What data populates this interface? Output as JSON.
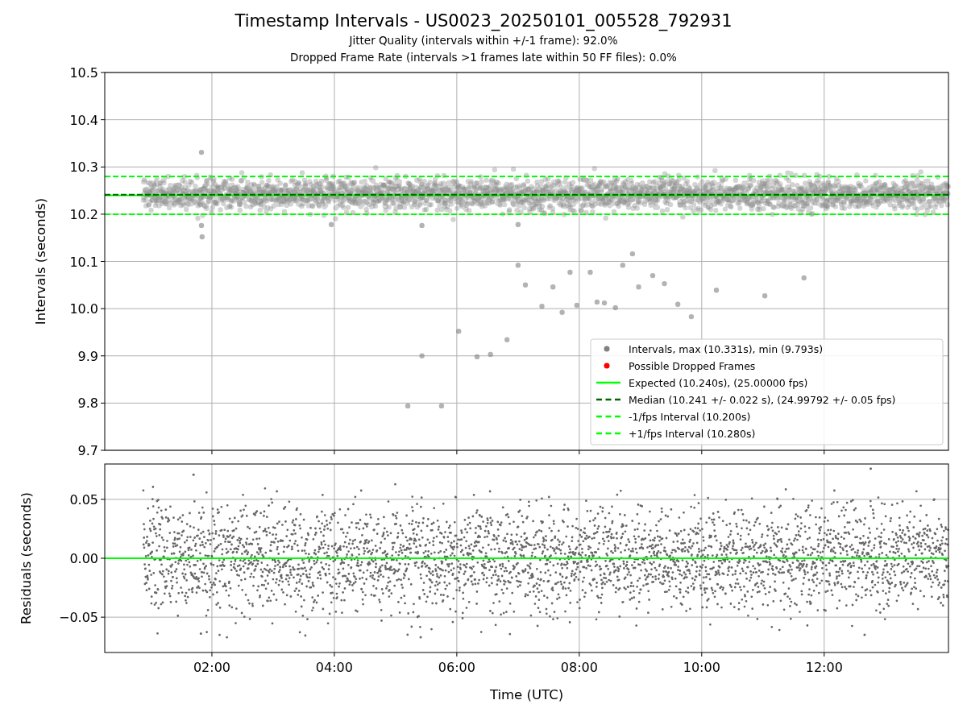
{
  "figure": {
    "title": "Timestamp Intervals - US0023_20250101_005528_792931",
    "subtitles": [
      "Jitter Quality (intervals within +/-1 frame): 92.0%",
      "Dropped Frame Rate (intervals >1 frames late within 50 FF files): 0.0%"
    ]
  },
  "intervals_plot": {
    "ylabel": "Intervals (seconds)",
    "yticks": [
      "10.5",
      "10.4",
      "10.3",
      "10.2",
      "10.1",
      "10.0",
      "9.9",
      "9.8",
      "9.7"
    ],
    "legend": [
      {
        "kind": "dot",
        "label": "Intervals, max (10.331s), min (9.793s)",
        "color": "#808080"
      },
      {
        "kind": "dot",
        "label": "Possible Dropped Frames",
        "color": "#ff0000"
      },
      {
        "kind": "solid-line",
        "label": "Expected (10.240s), (25.00000 fps)",
        "color": "#00ff00"
      },
      {
        "kind": "dashed-line",
        "label": "Median (10.241 +/- 0.022 s), (24.99792 +/- 0.05 fps)",
        "color": "#006400"
      },
      {
        "kind": "dashed-line",
        "label": "-1/fps Interval (10.200s)",
        "color": "#00ff00"
      },
      {
        "kind": "dashed-line",
        "label": "+1/fps Interval (10.280s)",
        "color": "#00ff00"
      }
    ]
  },
  "residuals_plot": {
    "ylabel": "Residuals (seconds)",
    "yticks": [
      "0.05",
      "0.00",
      "−0.05"
    ],
    "xticks": [
      "02:00",
      "04:00",
      "06:00",
      "08:00",
      "10:00",
      "12:00"
    ],
    "xlabel": "Time (UTC)"
  }
}
